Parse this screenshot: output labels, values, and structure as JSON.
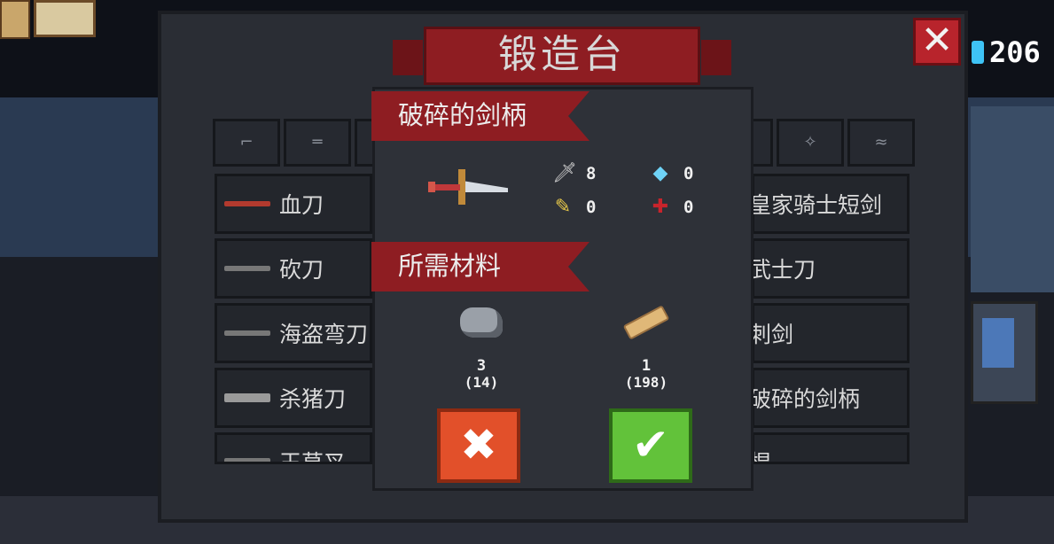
{
  "title": "锻造台",
  "currency": {
    "amount": "206",
    "icon": "gem-icon",
    "color": "#3ec3f5"
  },
  "close_label": "✕",
  "tabs": [
    {
      "icon": "pistol-icon",
      "glyph": "⌐"
    },
    {
      "icon": "rifle-icon",
      "glyph": "═"
    },
    {
      "icon": "shotgun-icon",
      "glyph": "═"
    },
    {
      "icon": "blue-weapon-icon",
      "glyph": "≈"
    },
    {
      "icon": "shuriken-icon",
      "glyph": "✧"
    },
    {
      "icon": "fish-weapon-icon",
      "glyph": "≈"
    }
  ],
  "weapons_left": [
    {
      "label": "血刀",
      "icon": "blood-blade-icon",
      "color": "#b23a2e"
    },
    {
      "label": "砍刀",
      "icon": "machete-icon",
      "color": "#8a8a8a"
    },
    {
      "label": "海盗弯刀",
      "icon": "cutlass-icon",
      "color": "#8a8a8a"
    },
    {
      "label": "杀猪刀",
      "icon": "butcher-knife-icon",
      "color": "#9a9a9a"
    },
    {
      "label": "王草叉",
      "icon": "pitchfork-icon",
      "color": "#8a8a8a"
    }
  ],
  "weapons_right": [
    {
      "label": "皇家骑士短剑"
    },
    {
      "label": "武士刀"
    },
    {
      "label": "刺剑"
    },
    {
      "label": "破碎的剑柄"
    },
    {
      "label": "棍"
    }
  ],
  "detail": {
    "item_name": "破碎的剑柄",
    "materials_heading": "所需材料",
    "stats": [
      {
        "icon": "sword-damage-icon",
        "glyph": "🗡",
        "value": "8",
        "color": "#d0d0d0"
      },
      {
        "icon": "energy-crystal-icon",
        "glyph": "◆",
        "value": "0",
        "color": "#6fd3f7"
      },
      {
        "icon": "crit-icon",
        "glyph": "✎",
        "value": "0",
        "color": "#e6c84a"
      },
      {
        "icon": "accuracy-cross-icon",
        "glyph": "✚",
        "value": "0",
        "color": "#c8242c"
      }
    ],
    "materials": [
      {
        "icon": "iron-ore-icon",
        "required": "3",
        "owned": "(14)"
      },
      {
        "icon": "wood-log-icon",
        "required": "1",
        "owned": "(198)"
      }
    ],
    "cancel_label": "✖",
    "confirm_label": "✔"
  }
}
